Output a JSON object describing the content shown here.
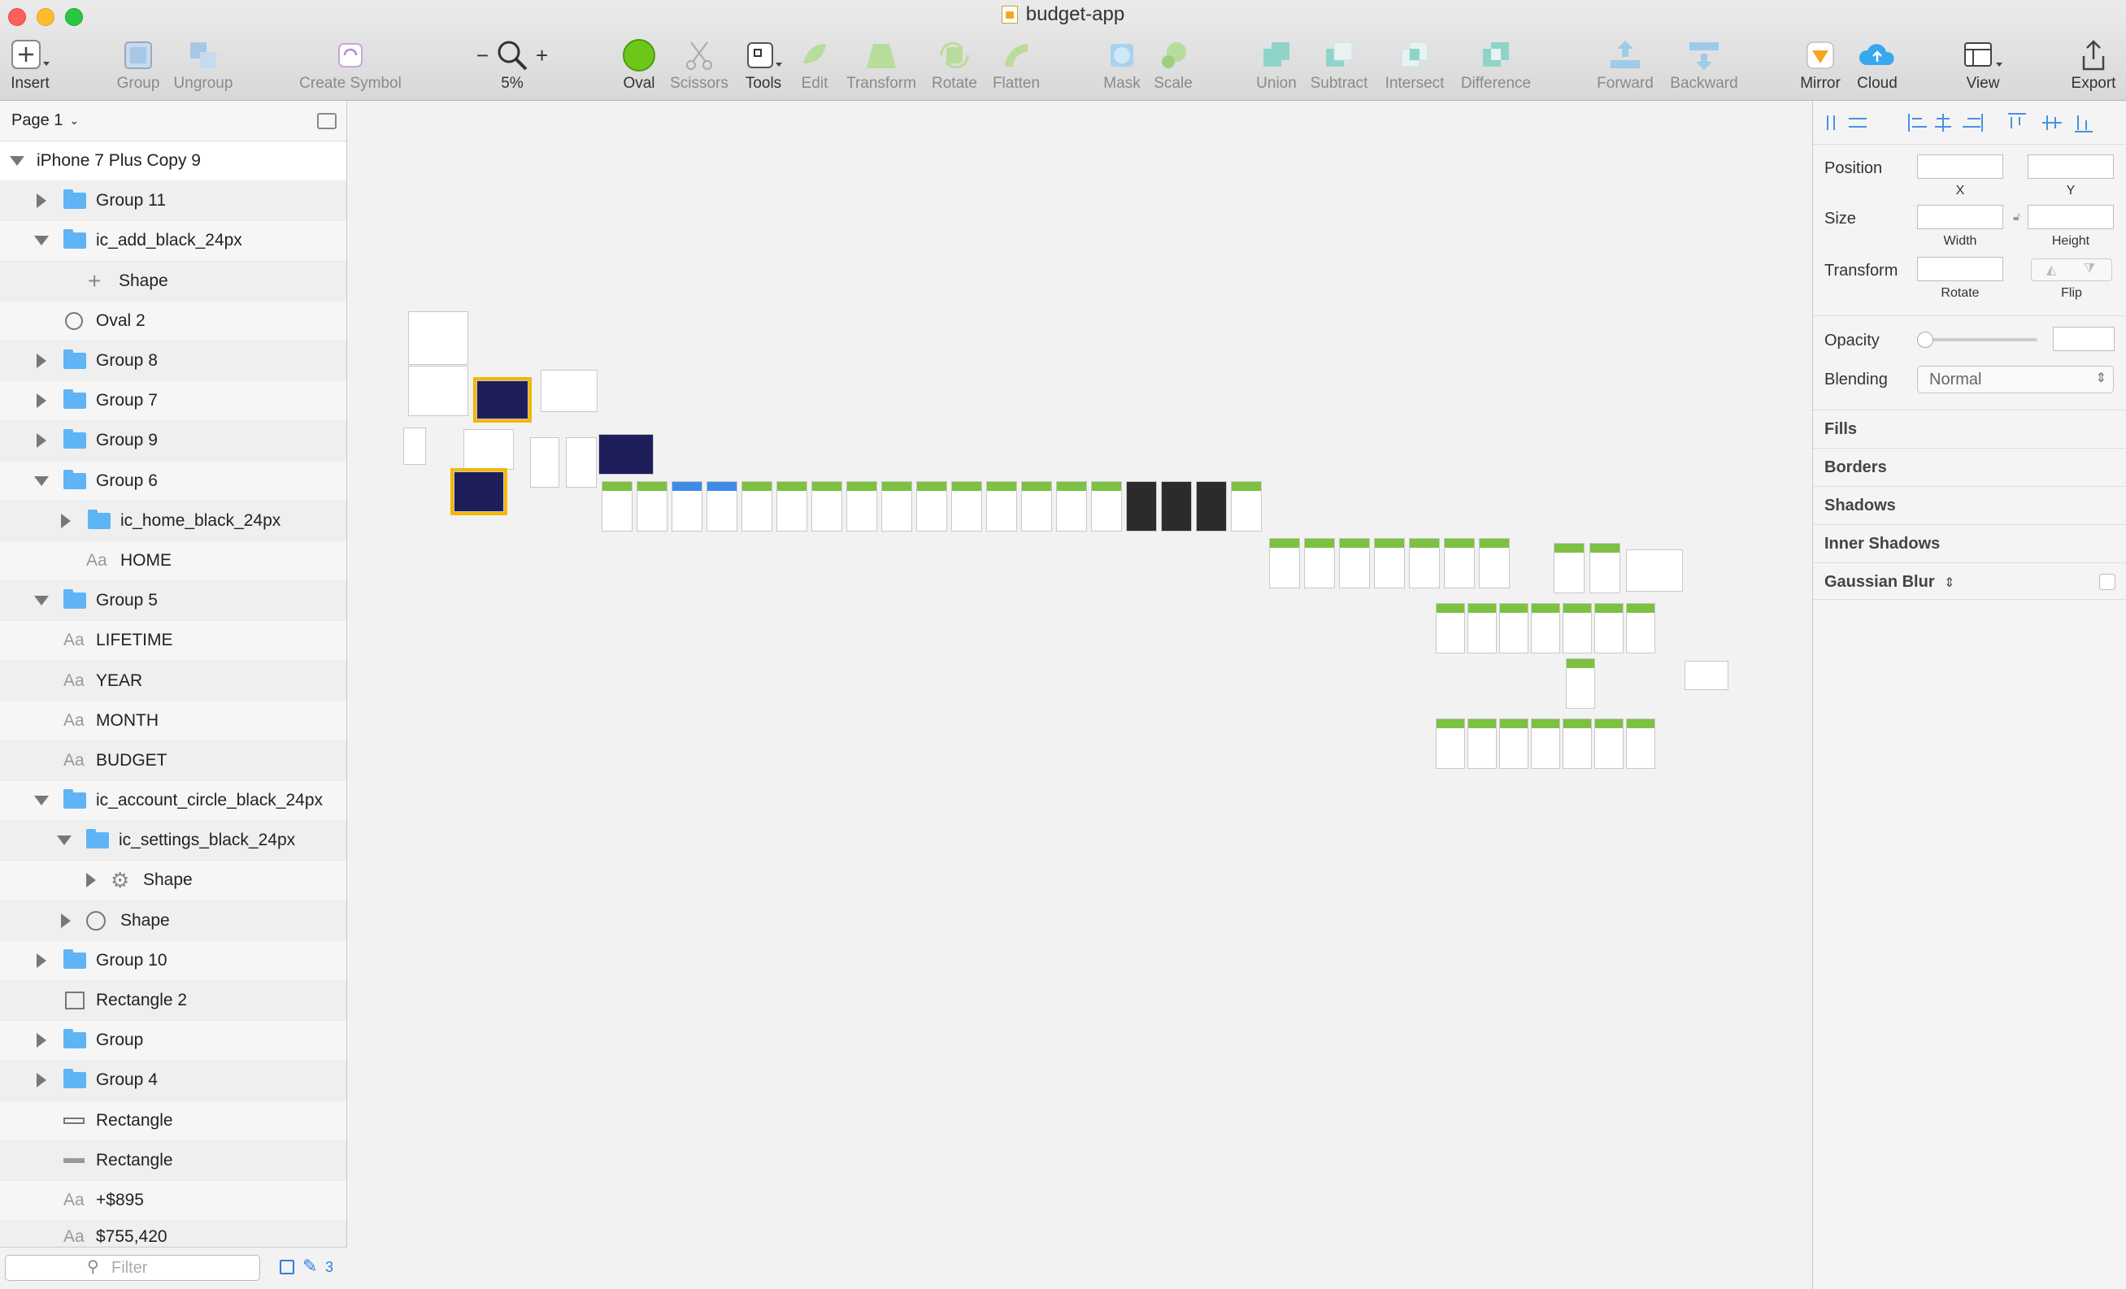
{
  "window": {
    "title": "budget-app"
  },
  "toolbar": {
    "insert": "Insert",
    "group": "Group",
    "ungroup": "Ungroup",
    "create_symbol": "Create Symbol",
    "zoom": "5%",
    "oval": "Oval",
    "scissors": "Scissors",
    "tools": "Tools",
    "edit": "Edit",
    "transform": "Transform",
    "rotate": "Rotate",
    "flatten": "Flatten",
    "mask": "Mask",
    "scale": "Scale",
    "union": "Union",
    "subtract": "Subtract",
    "intersect": "Intersect",
    "difference": "Difference",
    "forward": "Forward",
    "backward": "Backward",
    "mirror": "Mirror",
    "cloud": "Cloud",
    "view": "View",
    "export": "Export"
  },
  "layers": {
    "page": "Page 1",
    "artboard": "iPhone 7 Plus Copy 9",
    "items": [
      {
        "label": "Group 11"
      },
      {
        "label": "ic_add_black_24px"
      },
      {
        "label": "Shape"
      },
      {
        "label": "Oval 2"
      },
      {
        "label": "Group 8"
      },
      {
        "label": "Group 7"
      },
      {
        "label": "Group 9"
      },
      {
        "label": "Group 6"
      },
      {
        "label": "ic_home_black_24px"
      },
      {
        "label": "HOME"
      },
      {
        "label": "Group 5"
      },
      {
        "label": "LIFETIME"
      },
      {
        "label": "YEAR"
      },
      {
        "label": "MONTH"
      },
      {
        "label": "BUDGET"
      },
      {
        "label": "ic_account_circle_black_24px"
      },
      {
        "label": "ic_settings_black_24px"
      },
      {
        "label": "Shape"
      },
      {
        "label": "Shape"
      },
      {
        "label": "Group 10"
      },
      {
        "label": "Rectangle 2"
      },
      {
        "label": "Group"
      },
      {
        "label": "Group 4"
      },
      {
        "label": "Rectangle"
      },
      {
        "label": "Rectangle"
      },
      {
        "label": "+$895"
      },
      {
        "label": "$755,420"
      }
    ],
    "filter_placeholder": "Filter",
    "count": "3"
  },
  "inspector": {
    "position": "Position",
    "x": "X",
    "y": "Y",
    "size": "Size",
    "width": "Width",
    "height": "Height",
    "transform": "Transform",
    "rotate": "Rotate",
    "flip": "Flip",
    "opacity": "Opacity",
    "blending": "Blending",
    "blending_value": "Normal",
    "sections": [
      "Fills",
      "Borders",
      "Shadows",
      "Inner Shadows",
      "Gaussian Blur"
    ]
  },
  "colors": {
    "accent_green": "#7cc142",
    "folder_blue": "#5fb4f5",
    "selection": "#f5b700"
  }
}
